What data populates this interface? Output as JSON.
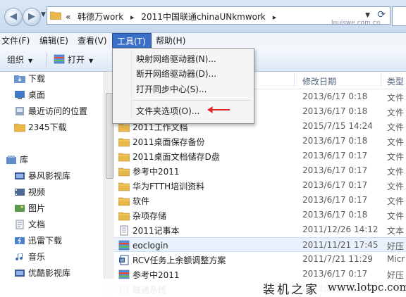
{
  "address": {
    "crumbs": [
      "«",
      "韩德万work",
      "2011中国联通chinaUNkmwork"
    ],
    "watermark": "louiswe.com.cn"
  },
  "menu": [
    "文件(F)",
    "编辑(E)",
    "查看(V)",
    "工具(T)",
    "帮助(H)"
  ],
  "toolbar": {
    "organize": "组织",
    "open": "打开"
  },
  "sidebar": {
    "favorites": [
      "下载",
      "桌面",
      "最近访问的位置",
      "2345下载"
    ],
    "library_label": "库",
    "libraries": [
      "暴风影视库",
      "视频",
      "图片",
      "文档",
      "迅雷下载",
      "音乐",
      "优酷影视库"
    ]
  },
  "columns": {
    "date": "修改日期",
    "type": "类型"
  },
  "dropdown": {
    "items": [
      "映射网络驱动器(N)...",
      "断开网络驱动器(D)...",
      "打开同步中心(S)...",
      "文件夹选项(O)..."
    ]
  },
  "files": [
    {
      "name": "",
      "date": "2013/6/17 0:18",
      "type": "文件",
      "icon": "folder"
    },
    {
      "name": "",
      "date": "2013/6/17 0:18",
      "type": "文件",
      "icon": "folder"
    },
    {
      "name": "2011工作文档",
      "date": "2015/7/15 14:24",
      "type": "文件",
      "icon": "folder"
    },
    {
      "name": "2011桌面保存备份",
      "date": "2013/6/17 0:18",
      "type": "文件",
      "icon": "folder"
    },
    {
      "name": "2011桌面文档储存D盘",
      "date": "2013/6/17 0:17",
      "type": "文件",
      "icon": "folder"
    },
    {
      "name": "参考中2011",
      "date": "2013/6/17 0:17",
      "type": "文件",
      "icon": "folder"
    },
    {
      "name": "华为FTTH培训资料",
      "date": "2013/6/17 0:17",
      "type": "文件",
      "icon": "folder"
    },
    {
      "name": "软件",
      "date": "2013/6/17 0:17",
      "type": "文件",
      "icon": "folder"
    },
    {
      "name": "杂项存储",
      "date": "2013/6/17 0:18",
      "type": "文件",
      "icon": "folder"
    },
    {
      "name": "2011记事本",
      "date": "2011/12/26 14:12",
      "type": "文本",
      "icon": "text"
    },
    {
      "name": "eoclogin",
      "date": "2011/11/21 17:45",
      "type": "好压",
      "icon": "archive"
    },
    {
      "name": "RCV任务上余额调整方案",
      "date": "2011/7/21 11:29",
      "type": "Micr",
      "icon": "word"
    },
    {
      "name": "参考中2011",
      "date": "2013/6/17 0:17",
      "type": "好压",
      "icon": "archive"
    },
    {
      "name": "联通系统",
      "date": "2011/8/15 10:50",
      "type": "",
      "icon": "text"
    }
  ],
  "footer_watermark": {
    "cn": "装机之家",
    "url": "www.lotpc.com"
  },
  "colors": {
    "menu_active": "#3a6fc8",
    "folder": "#e8b84a",
    "arrow": "#e0242a"
  }
}
